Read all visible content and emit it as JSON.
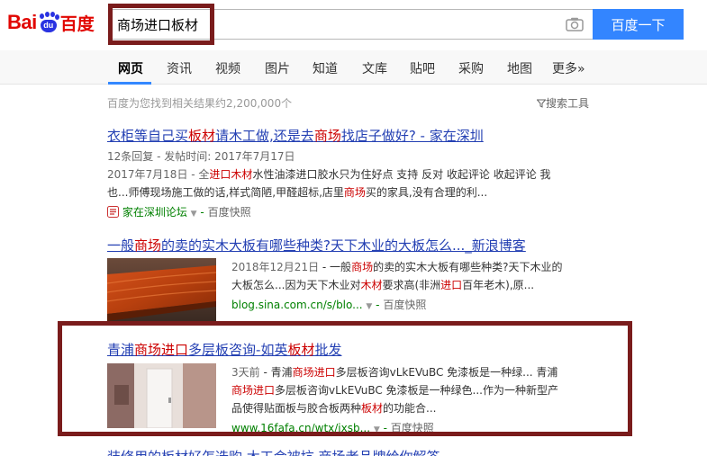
{
  "header": {
    "logo_bai": "Bai",
    "logo_du": "du",
    "logo_cn": "百度",
    "search_value": "商场进口板材",
    "search_button": "百度一下"
  },
  "tabs": [
    "网页",
    "资讯",
    "视频",
    "图片",
    "知道",
    "文库",
    "贴吧",
    "采购",
    "地图",
    "更多»"
  ],
  "results_meta": {
    "count_text": "百度为您找到相关结果约2,200,000个",
    "tools_label": "搜索工具"
  },
  "results": [
    {
      "title_parts": [
        "衣柜等自己买",
        "板材",
        "请木工做,还是去",
        "商场",
        "找店子做好? - 家在深圳"
      ],
      "meta": "12条回复 - 发帖时间: 2017年7月17日",
      "abstract_line1": [
        "2017年7月18日 - 全",
        "进口",
        "木材",
        "水性油漆进口胶水只为住好点 支持 反对 收起评论 收起评论 我"
      ],
      "abstract_line2": [
        "也...师傅现场施工做的话,样式简陋,甲醛超标,店里",
        "商场",
        "买的家具,没有合理的利..."
      ],
      "source": "家在深圳论坛",
      "cache": "百度快照"
    },
    {
      "title_parts": [
        "一般",
        "商场",
        "的卖的实木大板有哪些种类?天下木业的大板怎么..._新浪博客"
      ],
      "abstract_line1": [
        "2018年12月21日",
        " - 一般",
        "商场",
        "的卖的实木大板有哪些种类?天下木业的"
      ],
      "abstract_line2": [
        "大板怎么...因为天下木业对",
        "木材",
        "要求高(非洲",
        "进口",
        "百年老木),原..."
      ],
      "url": "blog.sina.com.cn/s/blo...",
      "cache": "百度快照"
    },
    {
      "title_parts": [
        "青浦",
        "商场进口",
        "多层板咨询-如英",
        "板材",
        "批发"
      ],
      "abstract_line1": [
        "3天前",
        " - 青浦",
        "商场进口",
        "多层板咨询vLkEVuBC 免漆板是一种绿... 青浦"
      ],
      "abstract_line2": [
        "商场进口",
        "多层板咨询vLkEVuBC 免漆板是一种绿色...作为一种新型产"
      ],
      "abstract_line3": [
        "品使得贴面板与胶合板两种",
        "板材",
        "的功能合..."
      ],
      "url": "www.16fafa.cn/wtx/jxsb...",
      "cache": "百度快照"
    },
    {
      "title_parts": [
        "装修用的板材好怎选购,木工会被坑,商场老品牌给你解答"
      ]
    }
  ]
}
